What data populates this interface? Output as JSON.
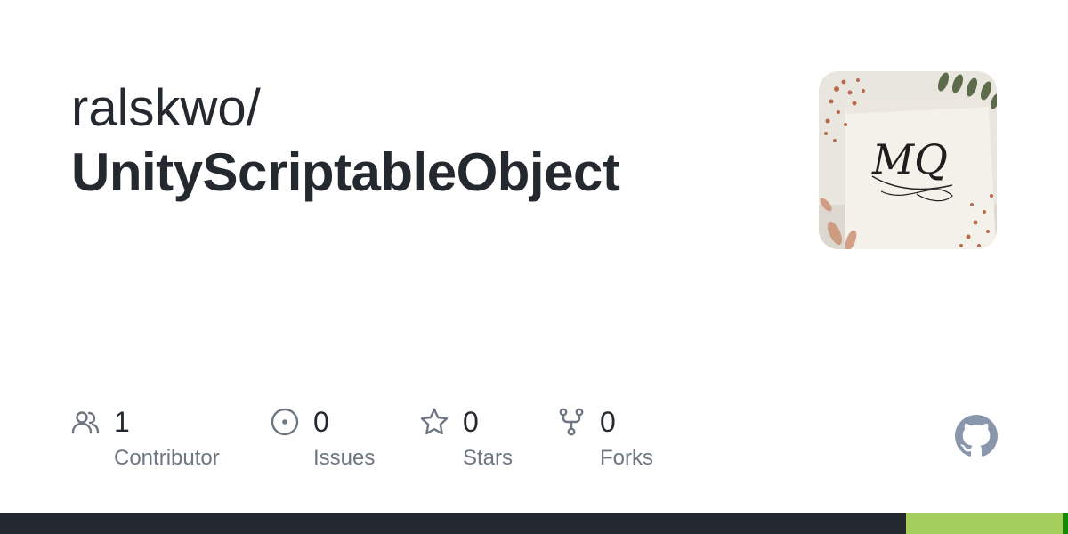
{
  "repo": {
    "owner": "ralskwo/",
    "name": "UnityScriptableObject"
  },
  "avatar": {
    "monogram": "MQ"
  },
  "stats": [
    {
      "icon": "people-icon",
      "value": "1",
      "label": "Contributor"
    },
    {
      "icon": "issue-icon",
      "value": "0",
      "label": "Issues"
    },
    {
      "icon": "star-icon",
      "value": "0",
      "label": "Stars"
    },
    {
      "icon": "fork-icon",
      "value": "0",
      "label": "Forks"
    }
  ],
  "footer_icon": "github-logo-icon",
  "language_bar": [
    {
      "color": "#24292f",
      "fraction": 0.848
    },
    {
      "color": "#a5cf5c",
      "fraction": 0.147
    },
    {
      "color": "#178600",
      "fraction": 0.005
    }
  ]
}
